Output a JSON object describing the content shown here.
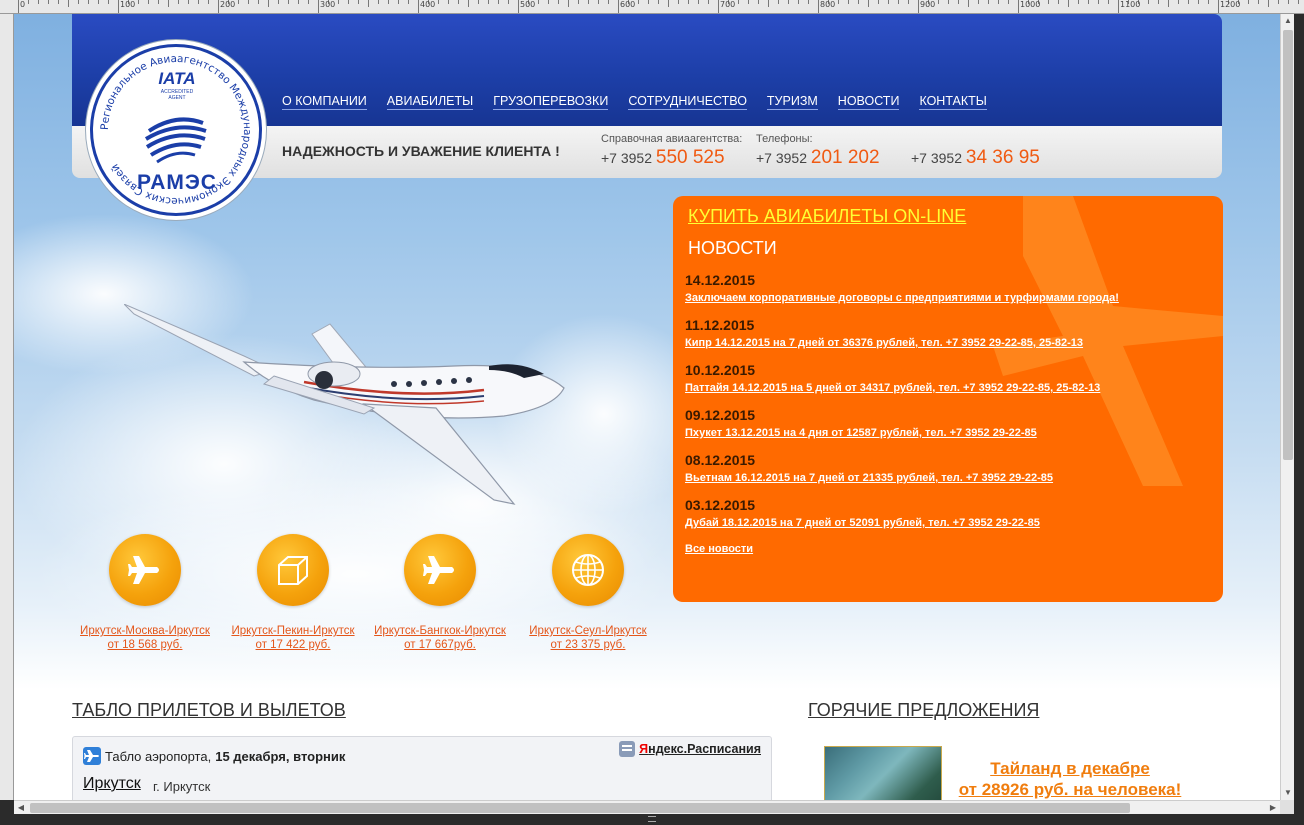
{
  "ruler": {
    "labels": [
      "0",
      "100",
      "200",
      "300",
      "400",
      "500",
      "600",
      "700",
      "800",
      "900",
      "1000",
      "1100",
      "1200"
    ]
  },
  "logo": {
    "ring_text": "Региональное Авиаагентство Международных Экономических Связей",
    "iata": "IATA",
    "iata_sub": "ACCREDITED AGENT",
    "brand": "РАМЭС"
  },
  "nav": [
    "О КОМПАНИИ",
    "АВИАБИЛЕТЫ",
    "ГРУЗОПЕРЕВОЗКИ",
    "СОТРУДНИЧЕСТВО",
    "ТУРИЗМ",
    "НОВОСТИ",
    "КОНТАКТЫ"
  ],
  "header": {
    "slogan": "НАДЕЖНОСТЬ И УВАЖЕНИЕ КЛИЕНТА !",
    "contact1_label": "Справочная авиаагентства:",
    "contact1_code": "+7 3952 ",
    "contact1_num": "550 525",
    "contact2_label": "Телефоны:",
    "contact2_code": "+7 3952 ",
    "contact2_num": "201 202",
    "contact3_code": "+7 3952 ",
    "contact3_num": "34 36 95"
  },
  "news": {
    "buy_link": "КУПИТЬ АВИАБИЛЕТЫ ON-LINE",
    "title": "НОВОСТИ",
    "items": [
      {
        "date": "14.12.2015",
        "text": "Заключаем корпоративные договоры с предприятиями и турфирмами города!"
      },
      {
        "date": "11.12.2015",
        "text": "Кипр 14.12.2015 на 7 дней от 36376 рублей, тел. +7 3952 29-22-85, 25-82-13"
      },
      {
        "date": "10.12.2015",
        "text": "Паттайя 14.12.2015 на 5 дней от 34317 рублей, тел. +7 3952 29-22-85, 25-82-13"
      },
      {
        "date": "09.12.2015",
        "text": "Пхукет 13.12.2015 на 4 дня от 12587 рублей, тел. +7 3952 29-22-85"
      },
      {
        "date": "08.12.2015",
        "text": "Вьетнам 16.12.2015 на 7 дней от 21335 рублей, тел. +7 3952 29-22-85"
      },
      {
        "date": "03.12.2015",
        "text": "Дубай 18.12.2015 на 7 дней от 52091 рублей, тел. +7 3952 29-22-85"
      }
    ],
    "all_link": "Все новости"
  },
  "routes": [
    {
      "icon": "plane-icon",
      "line1": "Иркутск-Москва-Иркутск",
      "line2": "от 18 568 руб."
    },
    {
      "icon": "box-icon",
      "line1": "Иркутск-Пекин-Иркутск",
      "line2": "от 17 422 руб."
    },
    {
      "icon": "plane-icon",
      "line1": "Иркутск-Бангкок-Иркутск",
      "line2": "от 17 667руб."
    },
    {
      "icon": "globe-icon",
      "line1": "Иркутск-Сеул-Иркутск",
      "line2": "от 23 375 руб."
    }
  ],
  "board": {
    "section_title": "ТАБЛО ПРИЛЕТОВ И ВЫЛЕТОВ",
    "prefix": "Табло аэропорта, ",
    "date": "15 декабря, вторник",
    "yandex_y": "Я",
    "yandex_rest": "ндекс.Расписания",
    "city": "Иркутск",
    "city_sub": "г. Иркутск"
  },
  "offers": {
    "section_title": "ГОРЯЧИЕ ПРЕДЛОЖЕНИЯ",
    "line1": "Тайланд в декабре",
    "line2": "от 28926 руб. на человека!"
  },
  "colors": {
    "accent_orange": "#ff6a00",
    "header_blue": "#1d3fa8",
    "link_orange": "#e4561a"
  }
}
